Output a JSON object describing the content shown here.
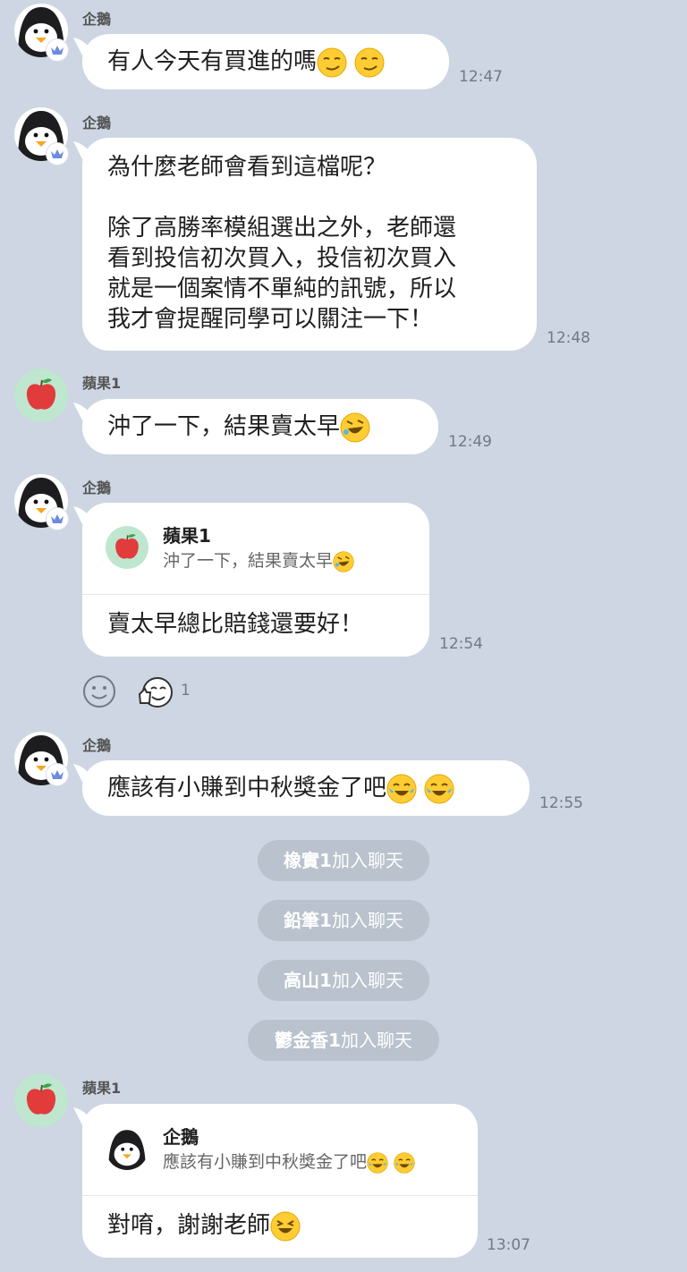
{
  "messages": [
    {
      "sender": "企鵝",
      "text": "有人今天有買進的嗎",
      "time": "12:47"
    },
    {
      "sender": "企鵝",
      "text": "為什麼老師會看到這檔呢？\n\n除了高勝率模組選出之外，老師還\n看到投信初次買入，投信初次買入\n就是一個案情不單純的訊號，所以\n我才會提醒同學可以關注一下！",
      "time": "12:48"
    },
    {
      "sender": "蘋果1",
      "text": "沖了一下，結果賣太早",
      "time": "12:49"
    },
    {
      "sender": "企鵝",
      "reply_to": {
        "name": "蘋果1",
        "text": "沖了一下，結果賣太早"
      },
      "text": "賣太早總比賠錢還要好！",
      "time": "12:54",
      "reaction_count": "1"
    },
    {
      "sender": "企鵝",
      "text": "應該有小賺到中秋獎金了吧",
      "time": "12:55"
    },
    {
      "sender": "蘋果1",
      "reply_to": {
        "name": "企鵝",
        "text": "應該有小賺到中秋獎金了吧"
      },
      "text": "對唷，謝謝老師",
      "time": "13:07"
    }
  ],
  "system_notices": [
    {
      "name": "橡實1",
      "action": "加入聊天"
    },
    {
      "name": "鉛筆1",
      "action": "加入聊天"
    },
    {
      "name": "高山1",
      "action": "加入聊天"
    },
    {
      "name": "鬱金香1",
      "action": "加入聊天"
    }
  ],
  "icons": [
    "penguin-avatar-icon",
    "apple-avatar-icon",
    "crown-badge-icon",
    "smirk-emoji-icon",
    "rofl-emoji-icon",
    "joy-emoji-icon",
    "laughing-emoji-icon",
    "add-reaction-icon",
    "thumbs-up-reaction-icon"
  ],
  "colors": {
    "background": "#cdd6e2",
    "bubble": "#ffffff",
    "system_pill": "#b9c2cd",
    "badge": "#6a8be0"
  }
}
